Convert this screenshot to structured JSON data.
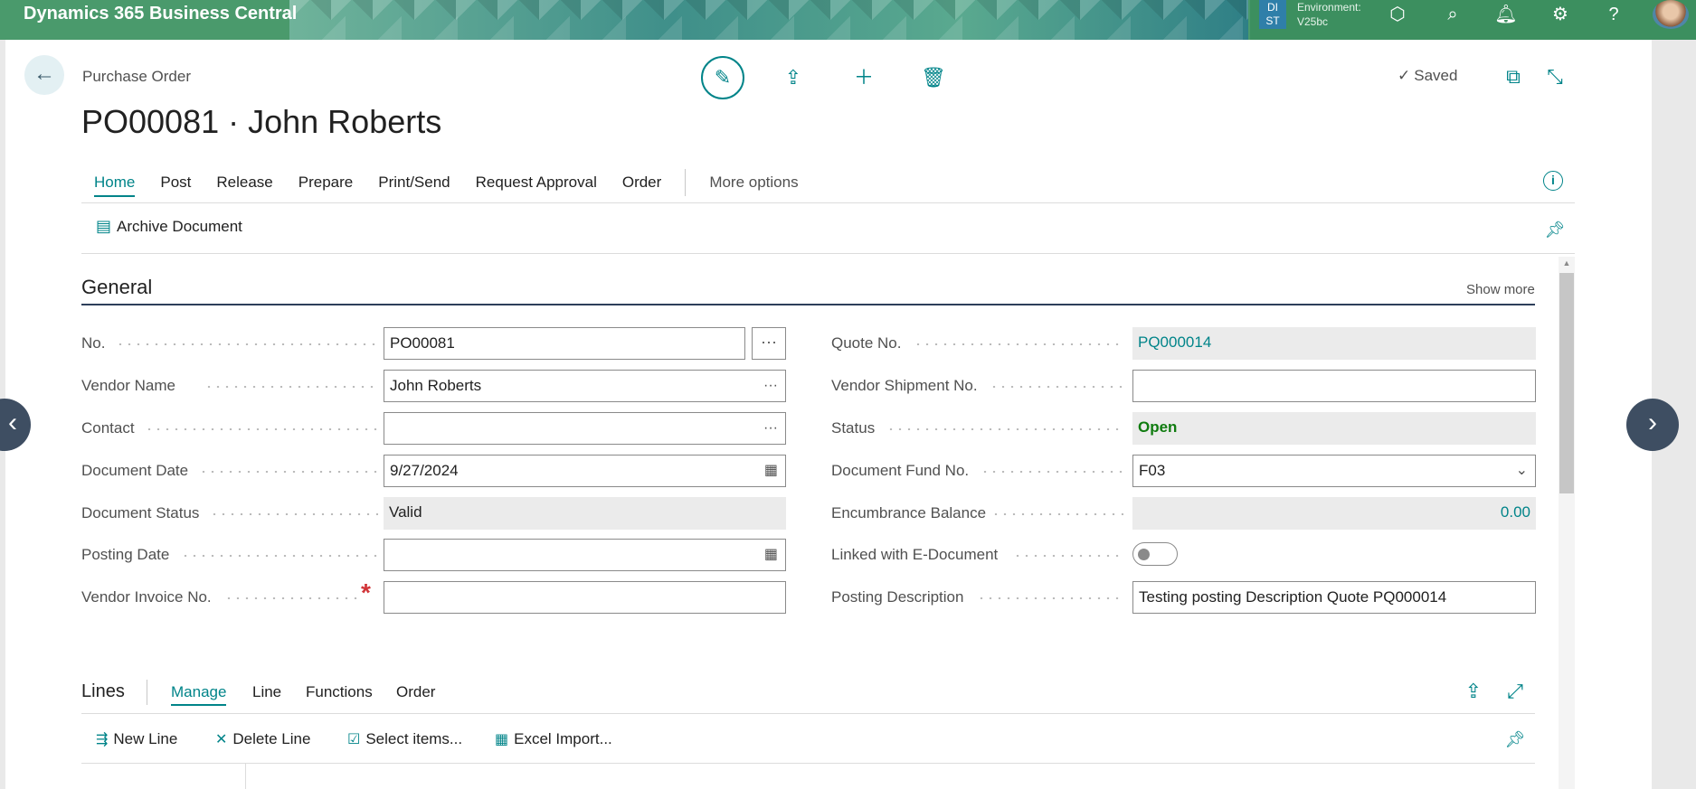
{
  "app": {
    "title": "Dynamics 365 Business Central",
    "env_badge_line1": "DI",
    "env_badge_line2": "ST",
    "env_label": "Environment:",
    "env_name": "V25bc"
  },
  "header": {
    "breadcrumb": "Purchase Order",
    "title": "PO00081 · John Roberts",
    "saved_label": "Saved"
  },
  "action_bar": {
    "items": [
      "Home",
      "Post",
      "Release",
      "Prepare",
      "Print/Send",
      "Request Approval",
      "Order"
    ],
    "more_label": "More options",
    "archive_label": "Archive Document"
  },
  "general": {
    "title": "General",
    "show_more": "Show more",
    "left": {
      "no_label": "No.",
      "no_value": "PO00081",
      "vendor_name_label": "Vendor Name",
      "vendor_name_value": "John Roberts",
      "contact_label": "Contact",
      "contact_value": "",
      "document_date_label": "Document Date",
      "document_date_value": "9/27/2024",
      "document_status_label": "Document Status",
      "document_status_value": "Valid",
      "posting_date_label": "Posting Date",
      "posting_date_value": "",
      "vendor_invoice_label": "Vendor Invoice No.",
      "vendor_invoice_value": ""
    },
    "right": {
      "quote_no_label": "Quote No.",
      "quote_no_value": "PQ000014",
      "vendor_shipment_label": "Vendor Shipment No.",
      "vendor_shipment_value": "",
      "status_label": "Status",
      "status_value": "Open",
      "fund_no_label": "Document Fund No.",
      "fund_no_value": "F03",
      "encumbrance_label": "Encumbrance Balance",
      "encumbrance_value": "0.00",
      "linked_label": "Linked with E-Document",
      "linked_value": false,
      "posting_desc_label": "Posting Description",
      "posting_desc_value": "Testing posting Description Quote PQ000014"
    }
  },
  "lines": {
    "title": "Lines",
    "tabs": [
      "Manage",
      "Line",
      "Functions",
      "Order"
    ],
    "actions": [
      "New Line",
      "Delete Line",
      "Select items...",
      "Excel Import..."
    ]
  },
  "colors": {
    "accent": "#008489",
    "appbar": "#4a9a6c",
    "status_open": "#107c10",
    "required": "#d13438"
  },
  "icons": {
    "back": "back-arrow-icon",
    "edit": "pencil-icon",
    "share": "share-icon",
    "new": "plus-icon",
    "delete": "trash-icon"
  }
}
